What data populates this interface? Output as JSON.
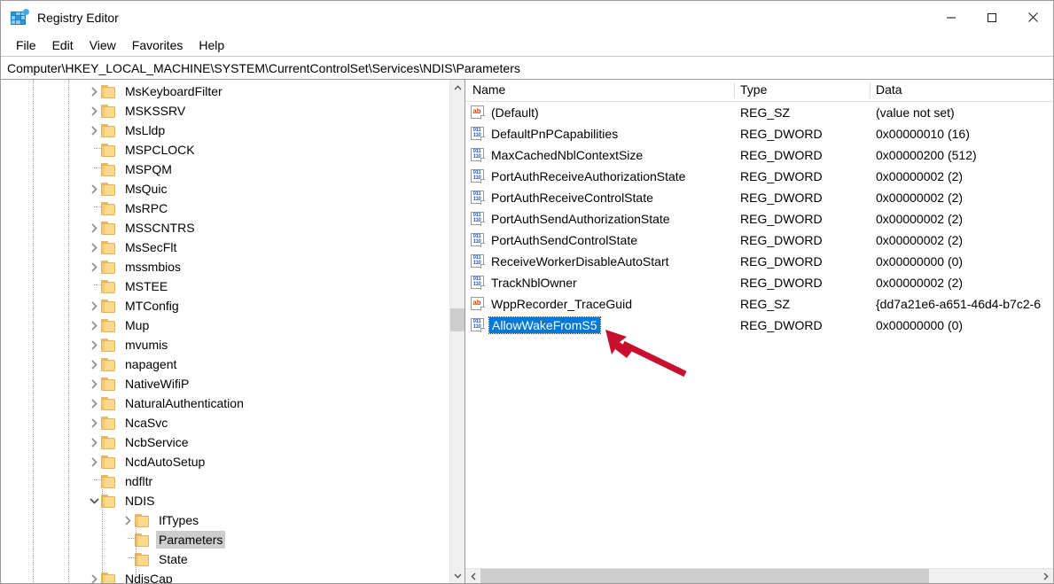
{
  "window": {
    "title": "Registry Editor",
    "icon": "registry-editor-icon",
    "controls": [
      {
        "name": "minimize-button",
        "glyph": "minimize-icon"
      },
      {
        "name": "maximize-button",
        "glyph": "maximize-icon"
      },
      {
        "name": "close-button",
        "glyph": "close-icon"
      }
    ]
  },
  "menubar": {
    "items": [
      {
        "label": "File"
      },
      {
        "label": "Edit"
      },
      {
        "label": "View"
      },
      {
        "label": "Favorites"
      },
      {
        "label": "Help"
      }
    ]
  },
  "address": {
    "path": "Computer\\HKEY_LOCAL_MACHINE\\SYSTEM\\CurrentControlSet\\Services\\NDIS\\Parameters"
  },
  "tree": {
    "items": [
      {
        "label": "MsKeyboardFilter",
        "indent": 0,
        "expander": "collapsed",
        "selected": false
      },
      {
        "label": "MSKSSRV",
        "indent": 0,
        "expander": "collapsed",
        "selected": false
      },
      {
        "label": "MsLldp",
        "indent": 0,
        "expander": "collapsed",
        "selected": false
      },
      {
        "label": "MSPCLOCK",
        "indent": 0,
        "expander": "leaf",
        "selected": false
      },
      {
        "label": "MSPQM",
        "indent": 0,
        "expander": "leaf",
        "selected": false
      },
      {
        "label": "MsQuic",
        "indent": 0,
        "expander": "collapsed",
        "selected": false
      },
      {
        "label": "MsRPC",
        "indent": 0,
        "expander": "leaf",
        "selected": false
      },
      {
        "label": "MSSCNTRS",
        "indent": 0,
        "expander": "collapsed",
        "selected": false
      },
      {
        "label": "MsSecFlt",
        "indent": 0,
        "expander": "collapsed",
        "selected": false
      },
      {
        "label": "mssmbios",
        "indent": 0,
        "expander": "collapsed",
        "selected": false
      },
      {
        "label": "MSTEE",
        "indent": 0,
        "expander": "leaf",
        "selected": false
      },
      {
        "label": "MTConfig",
        "indent": 0,
        "expander": "collapsed",
        "selected": false
      },
      {
        "label": "Mup",
        "indent": 0,
        "expander": "collapsed",
        "selected": false
      },
      {
        "label": "mvumis",
        "indent": 0,
        "expander": "collapsed",
        "selected": false
      },
      {
        "label": "napagent",
        "indent": 0,
        "expander": "collapsed",
        "selected": false
      },
      {
        "label": "NativeWifiP",
        "indent": 0,
        "expander": "collapsed",
        "selected": false
      },
      {
        "label": "NaturalAuthentication",
        "indent": 0,
        "expander": "collapsed",
        "selected": false
      },
      {
        "label": "NcaSvc",
        "indent": 0,
        "expander": "collapsed",
        "selected": false
      },
      {
        "label": "NcbService",
        "indent": 0,
        "expander": "collapsed",
        "selected": false
      },
      {
        "label": "NcdAutoSetup",
        "indent": 0,
        "expander": "collapsed",
        "selected": false
      },
      {
        "label": "ndfltr",
        "indent": 0,
        "expander": "leaf",
        "selected": false
      },
      {
        "label": "NDIS",
        "indent": 0,
        "expander": "expanded",
        "selected": false
      },
      {
        "label": "IfTypes",
        "indent": 1,
        "expander": "collapsed",
        "selected": false
      },
      {
        "label": "Parameters",
        "indent": 1,
        "expander": "leaf",
        "selected": true
      },
      {
        "label": "State",
        "indent": 1,
        "expander": "leaf",
        "selected": false
      },
      {
        "label": "NdisCap",
        "indent": 0,
        "expander": "collapsed",
        "selected": false
      }
    ]
  },
  "list": {
    "columns": [
      {
        "label": "Name"
      },
      {
        "label": "Type"
      },
      {
        "label": "Data"
      }
    ],
    "rows": [
      {
        "name": "(Default)",
        "type": "REG_SZ",
        "data": "(value not set)",
        "icon": "string-value-icon",
        "editing": false
      },
      {
        "name": "DefaultPnPCapabilities",
        "type": "REG_DWORD",
        "data": "0x00000010 (16)",
        "icon": "dword-value-icon",
        "editing": false
      },
      {
        "name": "MaxCachedNblContextSize",
        "type": "REG_DWORD",
        "data": "0x00000200 (512)",
        "icon": "dword-value-icon",
        "editing": false
      },
      {
        "name": "PortAuthReceiveAuthorizationState",
        "type": "REG_DWORD",
        "data": "0x00000002 (2)",
        "icon": "dword-value-icon",
        "editing": false
      },
      {
        "name": "PortAuthReceiveControlState",
        "type": "REG_DWORD",
        "data": "0x00000002 (2)",
        "icon": "dword-value-icon",
        "editing": false
      },
      {
        "name": "PortAuthSendAuthorizationState",
        "type": "REG_DWORD",
        "data": "0x00000002 (2)",
        "icon": "dword-value-icon",
        "editing": false
      },
      {
        "name": "PortAuthSendControlState",
        "type": "REG_DWORD",
        "data": "0x00000002 (2)",
        "icon": "dword-value-icon",
        "editing": false
      },
      {
        "name": "ReceiveWorkerDisableAutoStart",
        "type": "REG_DWORD",
        "data": "0x00000000 (0)",
        "icon": "dword-value-icon",
        "editing": false
      },
      {
        "name": "TrackNblOwner",
        "type": "REG_DWORD",
        "data": "0x00000002 (2)",
        "icon": "dword-value-icon",
        "editing": false
      },
      {
        "name": "WppRecorder_TraceGuid",
        "type": "REG_SZ",
        "data": "{dd7a21e6-a651-46d4-b7c2-6",
        "icon": "string-value-icon",
        "editing": false
      },
      {
        "name": "AllowWakeFromS5",
        "type": "REG_DWORD",
        "data": "0x00000000 (0)",
        "icon": "dword-value-icon",
        "editing": true
      }
    ]
  },
  "annotation": {
    "arrow_color": "#c8102e"
  },
  "icons": {
    "string_glyph": "ab",
    "dword_glyph_top": "011",
    "dword_glyph_bottom": "110"
  }
}
